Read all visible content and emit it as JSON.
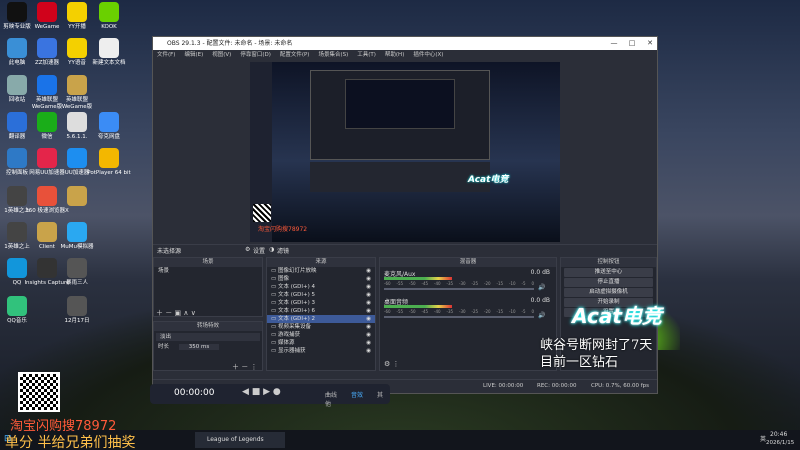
{
  "desktop": {
    "icons": [
      {
        "label": "剪映专业版",
        "color": "#111"
      },
      {
        "label": "WeGame",
        "color": "#d0021b"
      },
      {
        "label": "YY开播",
        "color": "#f4d000"
      },
      {
        "label": "KOOK",
        "color": "#6ad000"
      },
      {
        "label": "此电脑",
        "color": "#3a8fd6"
      },
      {
        "label": "ZZ加速器",
        "color": "#3a74e0"
      },
      {
        "label": "YY语音",
        "color": "#f4d000"
      },
      {
        "label": "新建文本文档",
        "color": "#eee"
      },
      {
        "label": "回收站",
        "color": "#8aa"
      },
      {
        "label": "英雄联盟WeGame版",
        "color": "#1a73e8"
      },
      {
        "label": "英雄联盟WeGame版",
        "color": "#c9a34a"
      },
      {
        "label": "翻译器",
        "color": "#2b6fd9"
      },
      {
        "label": "微信",
        "color": "#1aad19"
      },
      {
        "label": "5.6.1.1.",
        "color": "#ddd"
      },
      {
        "label": "夸克网盘",
        "color": "#3b8cf5"
      },
      {
        "label": "控制面板",
        "color": "#2e79c6"
      },
      {
        "label": "网易UU加速器",
        "color": "#e4254a"
      },
      {
        "label": "UU加速器",
        "color": "#1d8ef0"
      },
      {
        "label": "PotPlayer 64 bit",
        "color": "#f3b700"
      },
      {
        "label": "1英雄之上",
        "color": "#444"
      },
      {
        "label": "360 极速浏览器X",
        "color": "#e8513a"
      },
      {
        "label": "",
        "color": "#c9a34a"
      },
      {
        "label": "1英雄之上",
        "color": "#444"
      },
      {
        "label": "Client",
        "color": "#c9a34a"
      },
      {
        "label": "MuMu模拟器",
        "color": "#2aa8f1"
      },
      {
        "label": "QQ",
        "color": "#1296db"
      },
      {
        "label": "Insights Capture",
        "color": "#333"
      },
      {
        "label": "暴雨三人",
        "color": "#555"
      },
      {
        "label": "QQ音乐",
        "color": "#31c27c"
      },
      {
        "label": "12月17日",
        "color": "#555"
      }
    ]
  },
  "obs": {
    "title": "OBS 29.1.3 - 配置文件: 未命名 - 场景: 未命名",
    "menu": [
      "文件(F)",
      "编辑(E)",
      "视图(V)",
      "停靠窗口(D)",
      "配置文件(P)",
      "场景集合(S)",
      "工具(T)",
      "帮助(H)",
      "插件中心(X)"
    ],
    "source_props_bar": {
      "label": "未选择源",
      "gear": "设置",
      "filter": "滤镜"
    },
    "scenes": {
      "header": "场景",
      "items": [
        "场景"
      ]
    },
    "sources": {
      "header": "来源",
      "items": [
        "图像幻灯片放映",
        "图像",
        "文本 (GDI+) 4",
        "文本 (GDI+) 5",
        "文本 (GDI+) 3",
        "文本 (GDI+) 6",
        "文本 (GDI+) 2",
        "视频采集设备",
        "游戏捕获",
        "媒体源",
        "显示器捕获"
      ],
      "selected_index": 6
    },
    "mixer": {
      "header": "混音器",
      "channels": [
        {
          "name": "麦克风/Aux",
          "db": "0.0 dB",
          "level": 0.45
        },
        {
          "name": "桌面音频",
          "db": "0.0 dB",
          "level": 0.45
        }
      ],
      "ticks": [
        "-60",
        "-55",
        "-50",
        "-45",
        "-40",
        "-35",
        "-30",
        "-25",
        "-20",
        "-15",
        "-10",
        "-5",
        "0"
      ]
    },
    "transitions": {
      "header": "转场特效",
      "type": "淡出",
      "duration_label": "时长",
      "duration": "350 ms"
    },
    "controls": {
      "header": "控制按钮",
      "buttons": [
        "推送至中心",
        "停止直播",
        "启动虚拟摄像机",
        "开始录制",
        "设置"
      ]
    },
    "status": {
      "live": "LIVE: 00:00:00",
      "rec": "REC: 00:00:00",
      "cpu": "CPU: 0.7%, 60.00 fps"
    }
  },
  "overlay": {
    "acat": "Acat电竞",
    "caption1": "峡谷号断网封了7天",
    "caption2": "目前一区钻石",
    "promo1": "淘宝闪购搜78972",
    "promo2": "单分 半给兄弟们抽奖"
  },
  "player": {
    "time": "00:00:00",
    "tabs": [
      "曲线",
      "音效",
      "其他"
    ]
  },
  "taskbar": {
    "task": "League of Legends",
    "time": "20:46",
    "date": "2026/1/15",
    "lang": "英"
  },
  "preview_overlay": {
    "label": "淘宝闪购搜78972"
  }
}
